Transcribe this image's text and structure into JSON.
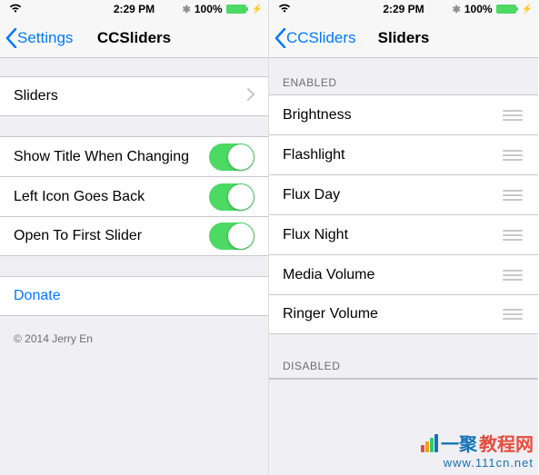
{
  "status": {
    "time": "2:29 PM",
    "battery_pct": "100%"
  },
  "left": {
    "nav": {
      "back": "Settings",
      "title": "CCSliders"
    },
    "row_sliders": "Sliders",
    "toggles": [
      {
        "label": "Show Title When Changing",
        "on": true
      },
      {
        "label": "Left Icon Goes Back",
        "on": true
      },
      {
        "label": "Open To First Slider",
        "on": true
      }
    ],
    "donate": "Donate",
    "copyright": "© 2014 Jerry En"
  },
  "right": {
    "nav": {
      "back": "CCSliders",
      "title": "Sliders"
    },
    "section_enabled": "ENABLED",
    "enabled_items": [
      "Brightness",
      "Flashlight",
      "Flux Day",
      "Flux Night",
      "Media Volume",
      "Ringer Volume"
    ],
    "section_disabled": "DISABLED"
  },
  "watermark": {
    "brand_a": "一聚",
    "brand_b": "教程网",
    "url": "www.111cn.net"
  }
}
